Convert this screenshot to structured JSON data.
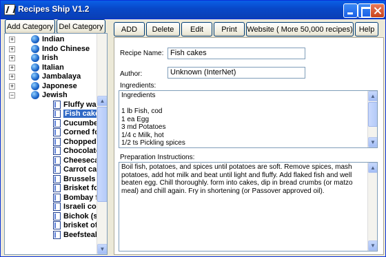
{
  "window": {
    "title": "Recipes Ship V1.2"
  },
  "left_buttons": {
    "add_category": "Add Category",
    "del_category": "Del Category"
  },
  "toolbar": {
    "add": "ADD",
    "delete": "Delete",
    "edit": "Edit",
    "print": "Print",
    "website": "Website ( More 50,000 recipes)",
    "help": "Help"
  },
  "tree": {
    "categories": [
      {
        "label": "Indian",
        "expander": "+"
      },
      {
        "label": "Indo Chinese",
        "expander": "+"
      },
      {
        "label": "Irish",
        "expander": "+"
      },
      {
        "label": "Italian",
        "expander": "+"
      },
      {
        "label": "Jambalaya",
        "expander": "+"
      },
      {
        "label": "Japonese",
        "expander": "+"
      },
      {
        "label": "Jewish",
        "expander": "−"
      }
    ],
    "recipes": [
      "Fluffy wal",
      "Fish cake",
      "Cucumbe",
      "Corned fc",
      "Chopped",
      "Chocolate",
      "Cheesecal",
      "Carrot ca",
      "Brussels :",
      "Brisket fo",
      "Bombay f",
      "Israeli co",
      "Bichok (s",
      "brisket of",
      "Beefsteal"
    ],
    "selected_recipe": "Fish cake"
  },
  "form": {
    "recipe_name_label": "Recipe Name:",
    "recipe_name_value": "Fish cakes",
    "author_label": "Author:",
    "author_value": "Unknown (InterNet)",
    "ingredients_label": "Ingredients:",
    "ingredients_lines": [
      "Ingredients",
      "",
      "1 lb Fish, cod",
      "1 ea Egg",
      "3 md Potatoes",
      "1/4 c Milk, hot",
      "1/2 ts Pickling spices"
    ],
    "instructions_label": "Preparation Instructions:",
    "instructions_text": "Boil fish, potatoes, and spices until potatoes are soft. Remove spices, mash potatoes, add hot milk and beat until light and fluffy. Add flaked fish and well beaten egg. Chill thoroughly. form into cakes, dip in bread crumbs (or matzo meal) and chill again. Fry in shortening (or Passover approved oil)."
  }
}
